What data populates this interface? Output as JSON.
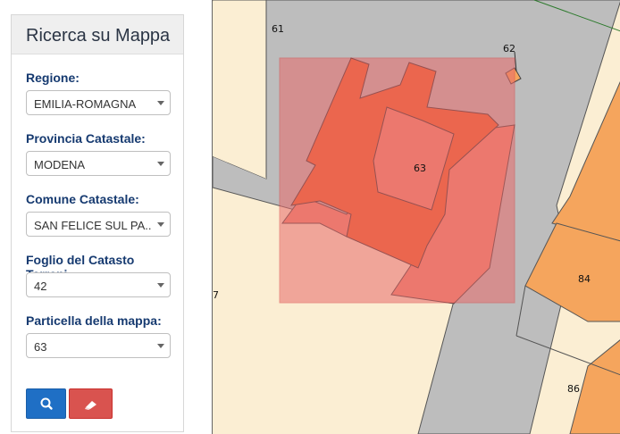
{
  "panel": {
    "title": "Ricerca su Mappa",
    "fields": [
      {
        "label": "Regione:",
        "value": "EMILIA-ROMAGNA"
      },
      {
        "label": "Provincia Catastale:",
        "value": "MODENA"
      },
      {
        "label": "Comune Catastale:",
        "value": "SAN FELICE SUL PA..."
      },
      {
        "label": "Foglio del Catasto Terreni:",
        "value": "42"
      },
      {
        "label": "Particella della mappa:",
        "value": "63"
      }
    ],
    "buttons": {
      "search_icon": "search-icon",
      "clear_icon": "eraser-icon"
    }
  },
  "map": {
    "parcel_labels": [
      "61",
      "62",
      "63",
      "84",
      "86",
      "7"
    ],
    "colors": {
      "land": "#fbeed3",
      "road": "#bdbdbd",
      "building": "#f5a55d",
      "selected_building": "#f0622c",
      "selection_overlay": "#e86a6a"
    }
  }
}
